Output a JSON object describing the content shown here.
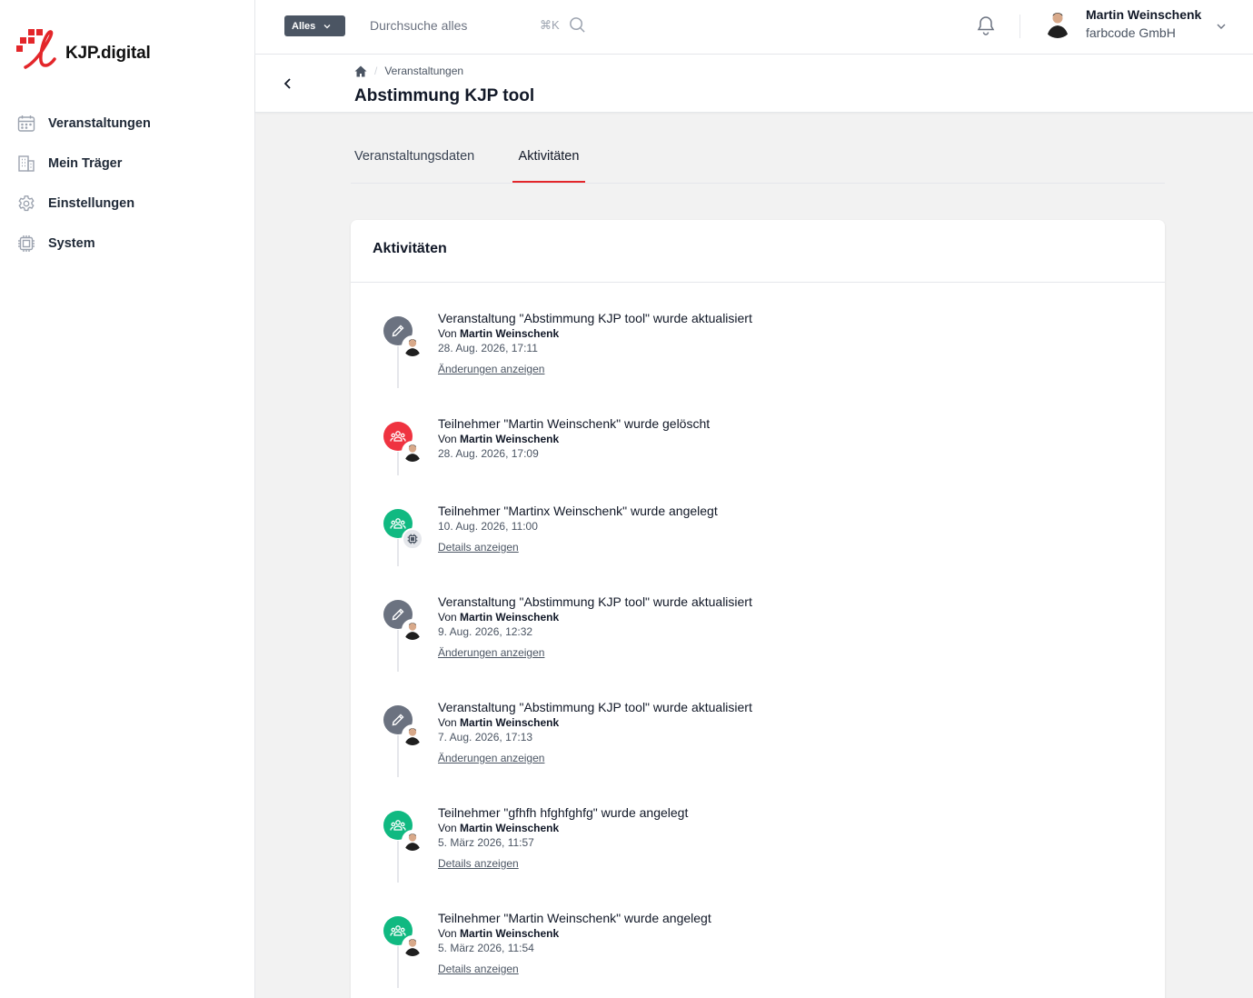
{
  "brand": {
    "name": "KJP.digital",
    "color": "#e3262a"
  },
  "sidebar": {
    "items": [
      {
        "label": "Veranstaltungen",
        "icon": "calendar-icon"
      },
      {
        "label": "Mein Träger",
        "icon": "building-icon"
      },
      {
        "label": "Einstellungen",
        "icon": "gear-icon"
      },
      {
        "label": "System",
        "icon": "chip-icon"
      }
    ]
  },
  "topbar": {
    "scope_label": "Alles",
    "search_placeholder": "Durchsuche alles",
    "shortcut": "⌘K",
    "user_name": "Martin Weinschenk",
    "user_org": "farbcode GmbH"
  },
  "header": {
    "breadcrumb": "Veranstaltungen",
    "title": "Abstimmung KJP tool"
  },
  "tabs": [
    {
      "label": "Veranstaltungsdaten",
      "active": false
    },
    {
      "label": "Aktivitäten",
      "active": true
    }
  ],
  "card": {
    "title": "Aktivitäten",
    "activities": [
      {
        "kind": "edit",
        "title": "Veranstaltung \"Abstimmung KJP tool\" wurde aktualisiert",
        "by_prefix": "Von",
        "by": "Martin Weinschenk",
        "date": "28. Aug. 2026, 17:11",
        "link": "Änderungen anzeigen"
      },
      {
        "kind": "delete",
        "title": "Teilnehmer \"Martin Weinschenk\" wurde gelöscht",
        "by_prefix": "Von",
        "by": "Martin Weinschenk",
        "date": "28. Aug. 2026, 17:09",
        "link": ""
      },
      {
        "kind": "create-system",
        "title": "Teilnehmer \"Martinx Weinschenk\" wurde angelegt",
        "by_prefix": "",
        "by": "",
        "date": "10. Aug. 2026, 11:00",
        "link": "Details anzeigen"
      },
      {
        "kind": "edit",
        "title": "Veranstaltung \"Abstimmung KJP tool\" wurde aktualisiert",
        "by_prefix": "Von",
        "by": "Martin Weinschenk",
        "date": "9. Aug. 2026, 12:32",
        "link": "Änderungen anzeigen"
      },
      {
        "kind": "edit",
        "title": "Veranstaltung \"Abstimmung KJP tool\" wurde aktualisiert",
        "by_prefix": "Von",
        "by": "Martin Weinschenk",
        "date": "7. Aug. 2026, 17:13",
        "link": "Änderungen anzeigen"
      },
      {
        "kind": "create",
        "title": "Teilnehmer \"gfhfh hfghfghfg\" wurde angelegt",
        "by_prefix": "Von",
        "by": "Martin Weinschenk",
        "date": "5. März 2026, 11:57",
        "link": "Details anzeigen"
      },
      {
        "kind": "create",
        "title": "Teilnehmer \"Martin Weinschenk\" wurde angelegt",
        "by_prefix": "Von",
        "by": "Martin Weinschenk",
        "date": "5. März 2026, 11:54",
        "link": "Details anzeigen"
      }
    ]
  },
  "colors": {
    "edit": "#6b7280",
    "delete": "#ef3340",
    "create": "#10b981"
  }
}
